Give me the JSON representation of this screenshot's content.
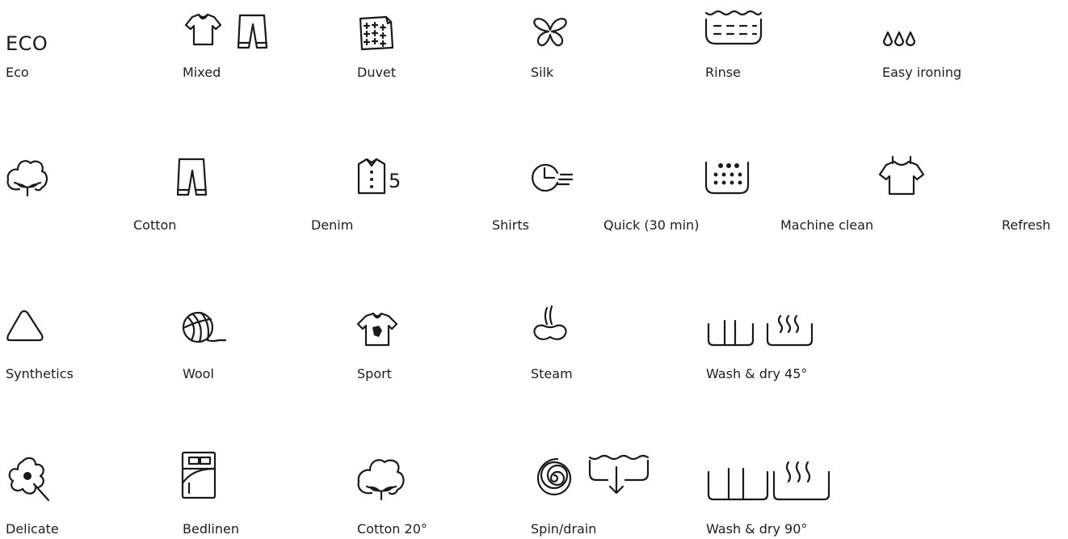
{
  "programs": {
    "eco": {
      "icon_text": "ECO",
      "label": "Eco",
      "icon": "eco-text-icon"
    },
    "mixed": {
      "label": "Mixed",
      "icon": "tshirt-and-trousers-icon"
    },
    "duvet": {
      "label": "Duvet",
      "icon": "duvet-icon"
    },
    "silk": {
      "label": "Silk",
      "icon": "butterfly-icon"
    },
    "rinse": {
      "label": "Rinse",
      "icon": "rinse-tub-icon"
    },
    "easy_ironing": {
      "label": "Easy ironing",
      "icon": "three-drops-icon"
    },
    "cotton_icon": {
      "icon": "cotton-flower-icon"
    },
    "cotton": {
      "label": "Cotton"
    },
    "denim": {
      "label": "Denim",
      "icon": "jeans-icon"
    },
    "shirts": {
      "label": "Shirts",
      "icon_text": "5",
      "icon": "shirt-five-icon"
    },
    "quick": {
      "label": "Quick (30 min)",
      "icon": "fast-clock-icon"
    },
    "machine_clean": {
      "label": "Machine clean",
      "icon": "drum-dots-icon"
    },
    "refresh": {
      "label": "Refresh",
      "icon": "hanging-tshirt-icon"
    },
    "synthetics": {
      "label": "Synthetics",
      "icon": "triangle-icon"
    },
    "wool": {
      "label": "Wool",
      "icon": "yarn-ball-icon"
    },
    "sport": {
      "label": "Sport",
      "icon": "sport-shirt-icon"
    },
    "steam": {
      "label": "Steam",
      "icon": "steam-icon"
    },
    "wash_dry_45": {
      "label": "Wash & dry 45°",
      "icon": "wash-dry-icon"
    },
    "delicate": {
      "label": "Delicate",
      "icon": "delicate-flower-icon"
    },
    "bedlinen": {
      "label": "Bedlinen",
      "icon": "bed-icon"
    },
    "cotton_20": {
      "label": "Cotton 20°",
      "icon": "cotton-flower-icon"
    },
    "spin_drain": {
      "label": "Spin/drain",
      "icon": "spin-drain-icon"
    },
    "wash_dry_90": {
      "label": "Wash & dry 90°",
      "icon": "wash-dry-large-icon"
    }
  }
}
